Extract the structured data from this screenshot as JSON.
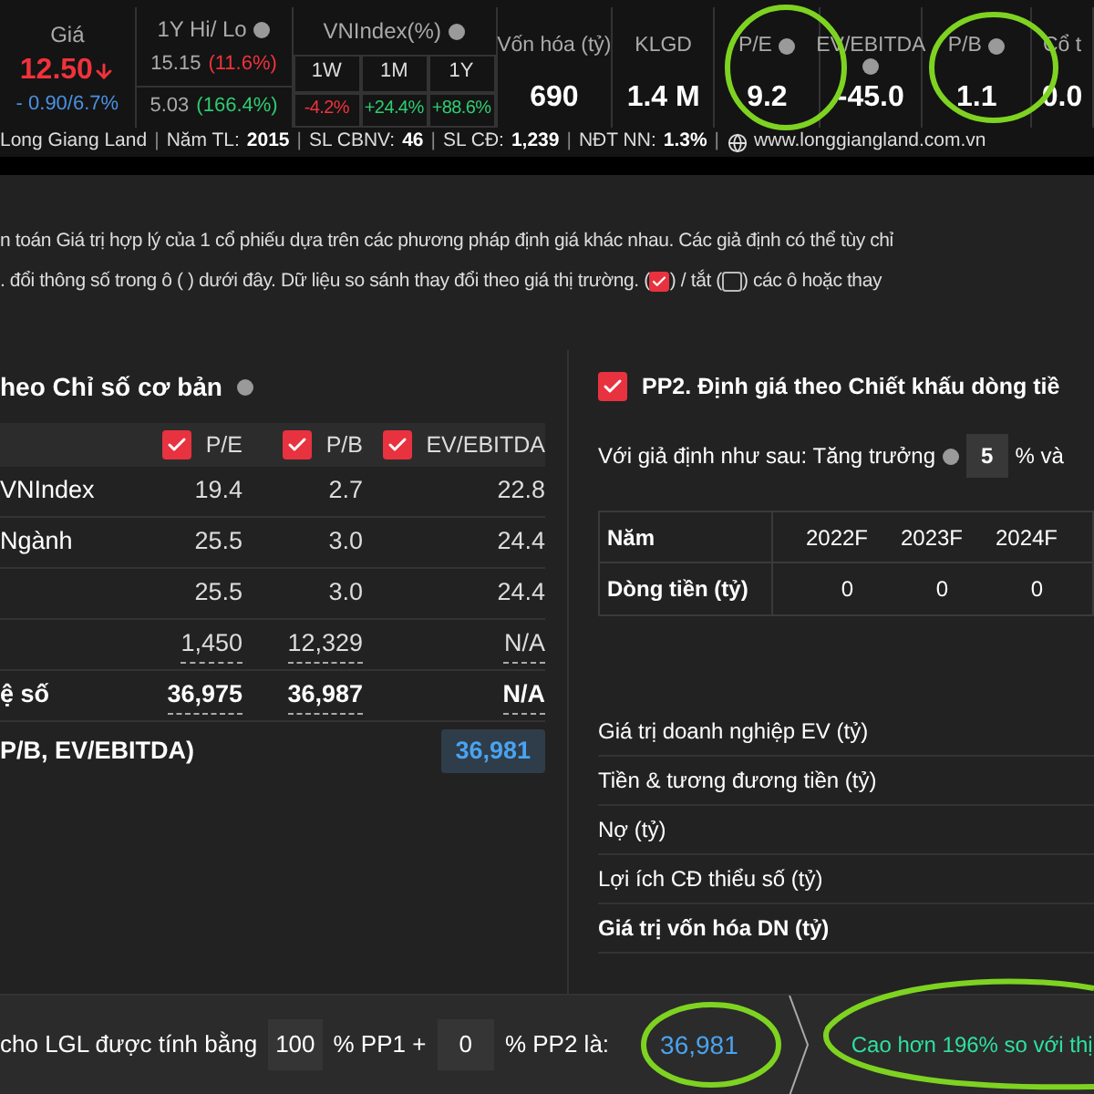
{
  "stats": [
    {
      "kind": "price",
      "label": "Giá",
      "value": "12.50",
      "change": "- 0.90/6.7%"
    },
    {
      "kind": "hilo",
      "label": "1Y Hi/ Lo",
      "hi": "15.15",
      "hi_pct": "(11.6%)",
      "lo": "5.03",
      "lo_pct": "(166.4%)"
    },
    {
      "kind": "vnindex",
      "label": "VNIndex(%)",
      "periods": [
        {
          "label": "1W",
          "value": "-4.2%"
        },
        {
          "label": "1M",
          "value": "+24.4%"
        },
        {
          "label": "1Y",
          "value": "+88.6%"
        }
      ]
    },
    {
      "kind": "simple",
      "label": "Vốn hóa (tỷ)",
      "value": "690",
      "info": false
    },
    {
      "kind": "simple",
      "label": "KLGD",
      "value": "1.4 M",
      "info": false
    },
    {
      "kind": "simple",
      "label": "P/E",
      "value": "9.2",
      "info": true
    },
    {
      "kind": "simple",
      "label": "EV/EBITDA",
      "value": "-45.0",
      "info": true
    },
    {
      "kind": "simple",
      "label": "P/B",
      "value": "1.1",
      "info": true
    },
    {
      "kind": "simple",
      "label": "Cổ t",
      "value": "0.0",
      "info": false
    }
  ],
  "company_info": [
    {
      "kind": "name",
      "label": "Long Giang Land"
    },
    {
      "kind": "separator",
      "label": "|"
    },
    {
      "kind": "field",
      "label": "Năm TL:",
      "value": "2015"
    },
    {
      "kind": "separator",
      "label": "|"
    },
    {
      "kind": "field",
      "label": "SL CBNV:",
      "value": "46"
    },
    {
      "kind": "separator",
      "label": "|"
    },
    {
      "kind": "field",
      "label": "SL CĐ:",
      "value": "1,239"
    },
    {
      "kind": "separator",
      "label": "|"
    },
    {
      "kind": "field",
      "label": "NĐT NN:",
      "value": "1.3%"
    },
    {
      "kind": "separator",
      "label": "|"
    }
  ],
  "website": "www.longgiangland.com.vn",
  "description": {
    "line1": "n toán Giá trị hợp lý của 1 cổ phiếu dựa trên các phương pháp định giá khác nhau. Các giả định có thể tùy chỉ",
    "line2_a": ". đổi thông số trong ô ( ) dưới đây. Dữ liệu so sánh thay đổi theo giá thị trường. (",
    "line2_b": ") / tắt (",
    "line2_c": ") các ô hoặc thay",
    "checkboxes": [
      {
        "checked": true
      },
      {
        "checked": false
      }
    ]
  },
  "pp1": {
    "title": "heo Chỉ số cơ bản",
    "columns": [
      {
        "label": "P/E",
        "checked": true
      },
      {
        "label": "P/B",
        "checked": true
      },
      {
        "label": "EV/EBITDA",
        "checked": true
      }
    ],
    "rows": [
      {
        "label": "VNIndex",
        "cells": [
          "19.4",
          "2.7",
          "22.8"
        ],
        "underlined": false,
        "bold": false
      },
      {
        "label": "Ngành",
        "cells": [
          "25.5",
          "3.0",
          "24.4"
        ],
        "underlined": false,
        "bold": false
      },
      {
        "cells": [
          "25.5",
          "3.0",
          "24.4"
        ],
        "underlined": false,
        "bold": false
      },
      {
        "cells": [
          "1,450",
          "12,329",
          "N/A"
        ],
        "underlined": true,
        "bold": false
      },
      {
        "label": "ệ số",
        "cells": [
          "36,975",
          "36,987",
          "N/A"
        ],
        "underlined": true,
        "bold": true
      }
    ],
    "result_label": "P/B, EV/EBITDA)",
    "result": "36,981"
  },
  "pp2": {
    "checked": true,
    "title": "PP2. Định giá theo Chiết khấu dòng tiề",
    "assumption_label": "Với giả định như sau: Tăng trưởng",
    "growth": "5",
    "assumption_tail": "% và",
    "table": {
      "header": [
        "Năm",
        "2022F",
        "2023F",
        "2024F"
      ],
      "rows": [
        [
          "Dòng tiền (tỷ)",
          "0",
          "0",
          "0"
        ]
      ]
    },
    "items": [
      {
        "label": "Giá trị doanh nghiệp EV (tỷ)",
        "bold": false
      },
      {
        "label": "Tiền & tương đương tiền (tỷ)",
        "bold": false
      },
      {
        "label": "Nợ (tỷ)",
        "bold": false
      },
      {
        "label": "Lợi ích CĐ thiểu số (tỷ)",
        "bold": false
      },
      {
        "label": "Giá trị vốn hóa DN (tỷ)",
        "bold": true
      }
    ]
  },
  "footer": {
    "text_a": "cho LGL được tính bằng",
    "pp1_weight": "100",
    "text_b": "% PP1 +",
    "pp2_weight": "0",
    "text_c": "% PP2 là:",
    "result": "36,981",
    "comparison": "Cao hơn 196% so với thị"
  }
}
